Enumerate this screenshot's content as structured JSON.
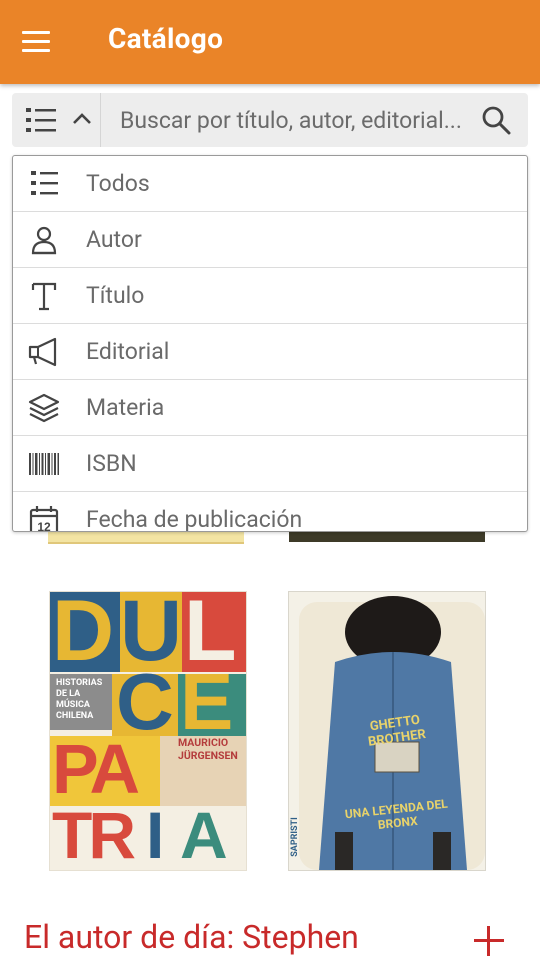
{
  "app_bar": {
    "title": "Catálogo",
    "menu_icon": "menu-icon"
  },
  "search": {
    "placeholder": "Buscar por título, autor, editorial...",
    "filter_icon": "list-icon",
    "toggle_icon": "chevron-up-icon",
    "search_icon": "search-icon"
  },
  "filter_menu": {
    "items": [
      {
        "label": "Todos",
        "icon": "list-icon"
      },
      {
        "label": "Autor",
        "icon": "person-icon"
      },
      {
        "label": "Título",
        "icon": "text-icon"
      },
      {
        "label": "Editorial",
        "icon": "megaphone-icon"
      },
      {
        "label": "Materia",
        "icon": "layers-icon"
      },
      {
        "label": "ISBN",
        "icon": "barcode-icon"
      },
      {
        "label": "Fecha de publicación",
        "icon": "calendar-icon"
      }
    ]
  },
  "books": [
    {
      "cover_letters": [
        "D",
        "U",
        "L",
        "C",
        "E",
        "PA",
        "TR",
        "I",
        "A"
      ],
      "subtitle_block": "HISTORIAS DE LA MÚSICA CHILENA",
      "author_first": "MAURICIO",
      "author_last": "JÜRGENSEN"
    },
    {
      "cover_top_text": "GHETTO BROTHER",
      "cover_bottom_text": "UNA LEYENDA DEL BRONX",
      "spine_text": "SAPRISTI"
    }
  ],
  "calendar_icon_text": "12",
  "author_section": {
    "title": "El autor de día: Stephen",
    "expand_icon": "plus-icon"
  },
  "colors": {
    "app_bar": "#ea8428",
    "accent_red": "#c82a2a",
    "search_bg": "#ededed"
  }
}
